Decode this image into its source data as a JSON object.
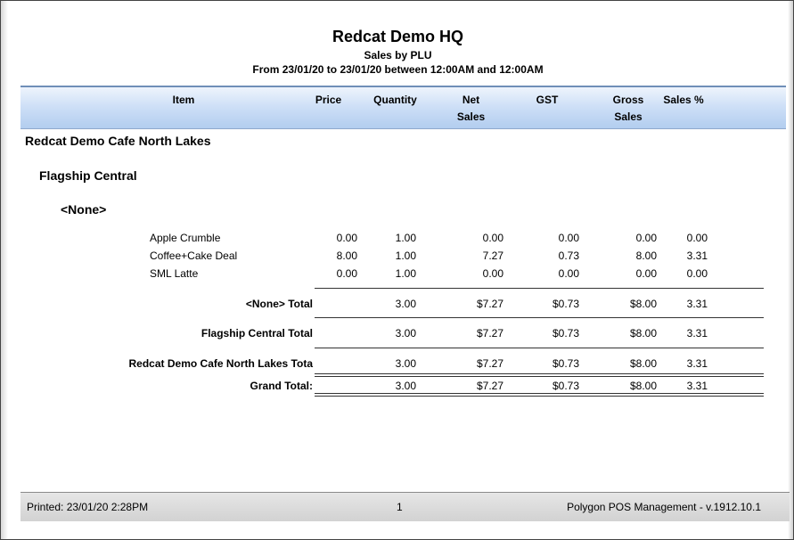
{
  "report": {
    "title": "Redcat Demo HQ",
    "subtitle": "Sales by PLU",
    "date_range": "From 23/01/20 to 23/01/20 between 12:00AM and 12:00AM"
  },
  "columns": {
    "item": "Item",
    "price": "Price",
    "quantity": "Quantity",
    "net_line1": "Net",
    "net_line2": "Sales",
    "gst": "GST",
    "gross_line1": "Gross",
    "gross_line2": "Sales",
    "sales_pct": "Sales %"
  },
  "groups": {
    "store": "Redcat Demo Cafe North Lakes",
    "department": "Flagship Central",
    "category": "<None>"
  },
  "rows": [
    {
      "item": "Apple Crumble",
      "price": "0.00",
      "quantity": "1.00",
      "net": "0.00",
      "gst": "0.00",
      "gross": "0.00",
      "pct": "0.00"
    },
    {
      "item": "Coffee+Cake Deal",
      "price": "8.00",
      "quantity": "1.00",
      "net": "7.27",
      "gst": "0.73",
      "gross": "8.00",
      "pct": "3.31"
    },
    {
      "item": "SML Latte",
      "price": "0.00",
      "quantity": "1.00",
      "net": "0.00",
      "gst": "0.00",
      "gross": "0.00",
      "pct": "0.00"
    }
  ],
  "totals": [
    {
      "label": "<None> Total",
      "quantity": "3.00",
      "net": "$7.27",
      "gst": "$0.73",
      "gross": "$8.00",
      "pct": "3.31"
    },
    {
      "label": "Flagship Central Total",
      "quantity": "3.00",
      "net": "$7.27",
      "gst": "$0.73",
      "gross": "$8.00",
      "pct": "3.31"
    },
    {
      "label": "Redcat Demo Cafe North Lakes Tota",
      "quantity": "3.00",
      "net": "$7.27",
      "gst": "$0.73",
      "gross": "$8.00",
      "pct": "3.31"
    },
    {
      "label": "Grand Total:",
      "quantity": "3.00",
      "net": "$7.27",
      "gst": "$0.73",
      "gross": "$8.00",
      "pct": "3.31"
    }
  ],
  "footer": {
    "printed": "Printed: 23/01/20   2:28PM",
    "page_number": "1",
    "app_version": "Polygon POS Management - v.1912.10.1"
  }
}
